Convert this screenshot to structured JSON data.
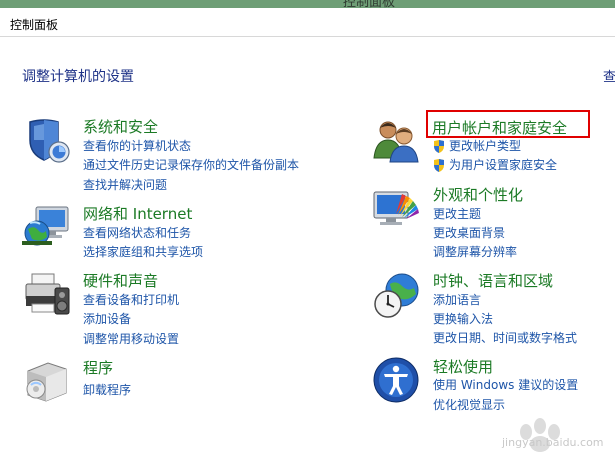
{
  "window": {
    "title": "控制面板"
  },
  "addressbar": {
    "crumb": "控制面板"
  },
  "page": {
    "title": "调整计算机的设置",
    "right_cutoff": "查"
  },
  "categories": {
    "system_security": {
      "title": "系统和安全",
      "links": [
        "查看你的计算机状态",
        "通过文件历史记录保存你的文件备份副本",
        "查找并解决问题"
      ]
    },
    "network": {
      "title": "网络和 Internet",
      "links": [
        "查看网络状态和任务",
        "选择家庭组和共享选项"
      ]
    },
    "hardware": {
      "title": "硬件和声音",
      "links": [
        "查看设备和打印机",
        "添加设备",
        "调整常用移动设置"
      ]
    },
    "programs": {
      "title": "程序",
      "links": [
        "卸载程序"
      ]
    },
    "user_accounts": {
      "title": "用户帐户和家庭安全",
      "links": [
        "更改帐户类型",
        "为用户设置家庭安全"
      ]
    },
    "appearance": {
      "title": "外观和个性化",
      "links": [
        "更改主题",
        "更改桌面背景",
        "调整屏幕分辨率"
      ]
    },
    "clock": {
      "title": "时钟、语言和区域",
      "links": [
        "添加语言",
        "更换输入法",
        "更改日期、时间或数字格式"
      ]
    },
    "ease": {
      "title": "轻松使用",
      "links": [
        "使用 Windows 建议的设置",
        "优化视觉显示"
      ]
    }
  },
  "watermark": {
    "text": "jingyan.baidu.com"
  },
  "colors": {
    "heading": "#1b7a25",
    "link": "#1e55a8",
    "highlight": "#e00000"
  }
}
